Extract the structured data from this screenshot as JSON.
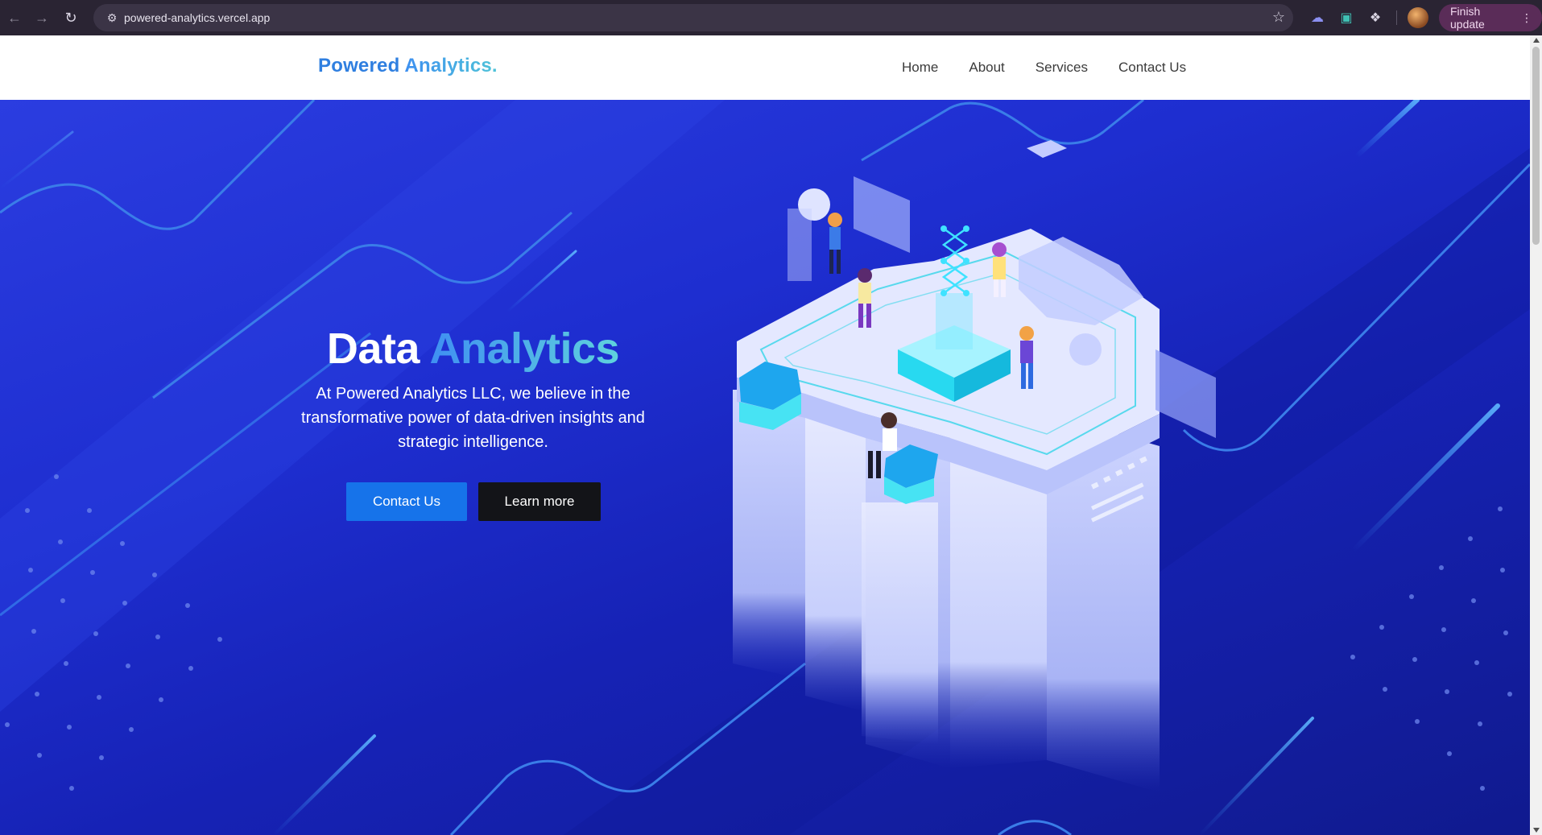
{
  "browser": {
    "url": "powered-analytics.vercel.app",
    "finish_update_label": "Finish update"
  },
  "site": {
    "logo_part1": "Powered",
    "logo_part2": "Analytics.",
    "nav": [
      "Home",
      "About",
      "Services",
      "Contact Us"
    ]
  },
  "hero": {
    "title_part1": "Data",
    "title_part2": "Analytics",
    "text": "At Powered Analytics LLC, we believe in the transformative power of data-driven insights and strategic intelligence.",
    "primary_button": "Contact Us",
    "secondary_button": "Learn more"
  },
  "colors": {
    "brand_blue": "#1673ea",
    "hero_bg": "#1e2ed0",
    "accent_cyan": "#5fd3dd"
  }
}
